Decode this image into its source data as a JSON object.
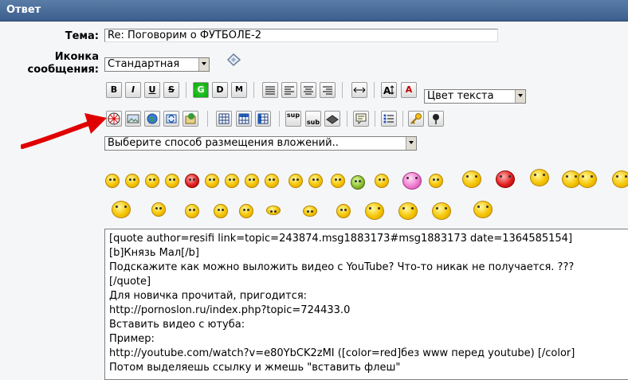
{
  "header": {
    "title": "Ответ"
  },
  "form": {
    "subject_label": "Тема:",
    "subject_value": "Re: Поговорим о ФУТБОЛЕ-2",
    "icon_label_1": "Иконка",
    "icon_label_2": "сообщения:",
    "icon_select": "Стандартная",
    "color_select": "Цвет текста",
    "attach_select": "Выберите способ размещения вложений.."
  },
  "toolbar": {
    "bold": "B",
    "italic": "I",
    "underline": "U",
    "strike": "S",
    "glow": "G",
    "shadow": "D",
    "marquee": "M",
    "sup": "sup",
    "sub": "sub",
    "teletype": "A"
  },
  "editor": {
    "lines": [
      "[quote author=resifi link=topic=243874.msg1883173#msg1883173 date=1364585154]",
      "[b]Князь Мал[/b]",
      "Подскажите как можно выложить видео с YouTube? Что-то никак не получается. ???",
      "[/quote]",
      "Для новичка прочитай, пригодится:",
      "http://pornoslon.ru/index.php?topic=724433.0",
      "Вставить видео с ютуба:",
      "Пример:",
      "http://youtube.com/watch?v=e80YbCK2zMI ([color=red]без www перед youtube) [/color]",
      "Потом выделяешь ссылку и жмешь \"вставить флеш\""
    ]
  },
  "colors": {
    "title_bg": "#3b5e8c",
    "arrow": "#e00000"
  }
}
